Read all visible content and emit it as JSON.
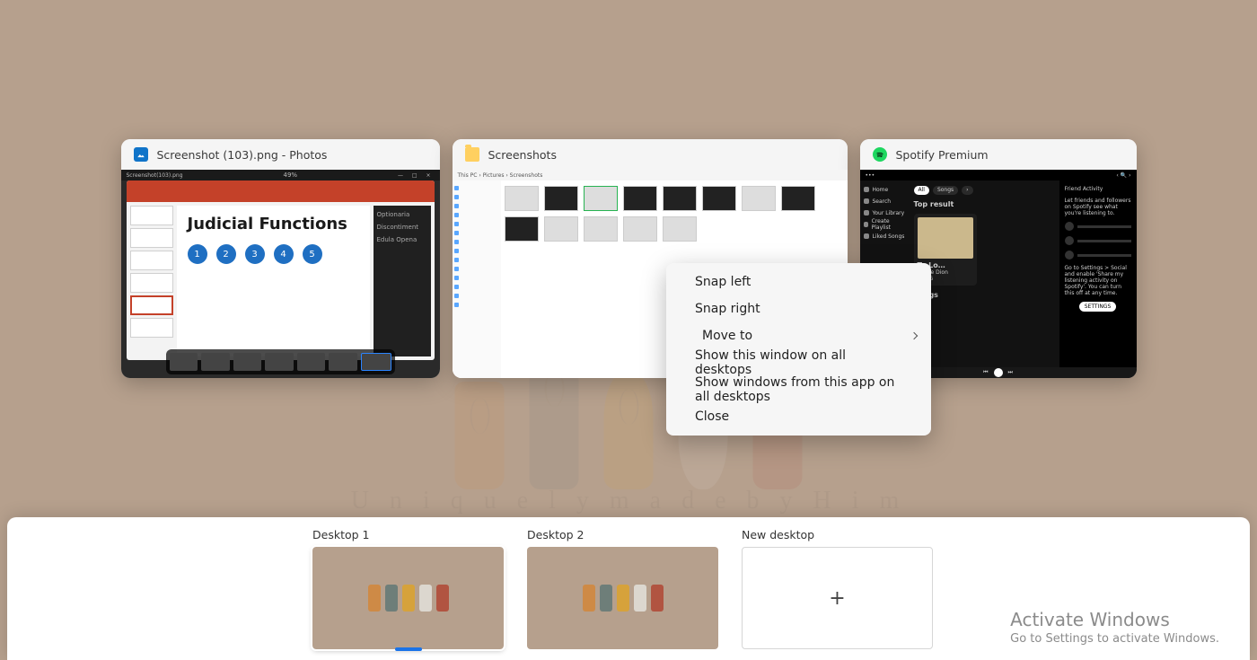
{
  "wallpaper": {
    "caption": "U n i q u e l y   m a d e   b y   H i m"
  },
  "windows": {
    "photos": {
      "title": "Screenshot (103).png - Photos",
      "zoom": "49%",
      "slide_title": "Judicial Functions",
      "bullets": [
        "1",
        "2",
        "3",
        "4",
        "5"
      ],
      "side": [
        "Optionaria",
        "Discontiment",
        "Edula Opena"
      ]
    },
    "explorer": {
      "title": "Screenshots",
      "path": "This PC  ›  Pictures  ›  Screenshots"
    },
    "spotify": {
      "title": "Spotify Premium",
      "nav": [
        "Home",
        "Search",
        "Your Library",
        "Create Playlist",
        "Liked Songs"
      ],
      "pill_on": "All",
      "pill_off1": "Songs",
      "top_result_label": "Top result",
      "track": "To Lo…",
      "artist": "Céline Dion",
      "tag": "SONG",
      "songs_label": "Songs",
      "friend_header": "Friend Activity",
      "friend_text": "Let friends and followers on Spotify see what you're listening to.",
      "friend_hint": "Go to Settings > Social and enable 'Share my listening activity on Spotify'. You can turn this off at any time.",
      "settings_btn": "SETTINGS"
    }
  },
  "context_menu": {
    "snap_left": "Snap left",
    "snap_right": "Snap right",
    "move_to": "Move to",
    "show_all": "Show this window on all desktops",
    "show_app_all": "Show windows from this app on all desktops",
    "close": "Close"
  },
  "desktops": {
    "d1": "Desktop 1",
    "d2": "Desktop 2",
    "new": "New desktop"
  },
  "watermark": {
    "title": "Activate Windows",
    "sub": "Go to Settings to activate Windows."
  }
}
